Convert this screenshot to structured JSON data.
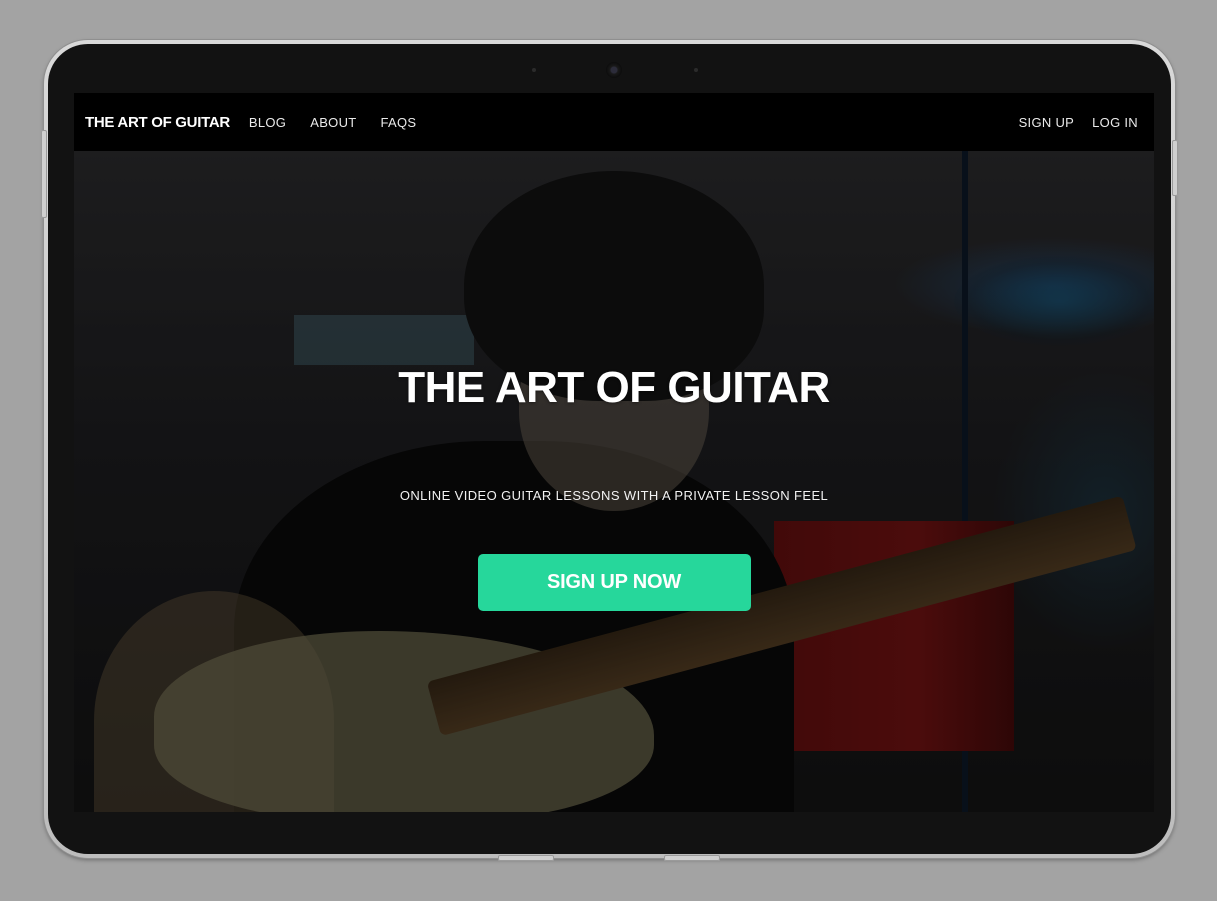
{
  "nav": {
    "brand": "THE ART OF GUITAR",
    "links": [
      "BLOG",
      "ABOUT",
      "FAQS"
    ],
    "sign_up": "SIGN UP",
    "log_in": "LOG IN"
  },
  "hero": {
    "title": "THE ART OF GUITAR",
    "subtitle": "ONLINE VIDEO GUITAR LESSONS WITH A PRIVATE LESSON FEEL",
    "cta_label": "SIGN UP NOW"
  },
  "colors": {
    "accent": "#26d79b",
    "nav_bg": "#000000",
    "device_bezel": "#121212"
  }
}
